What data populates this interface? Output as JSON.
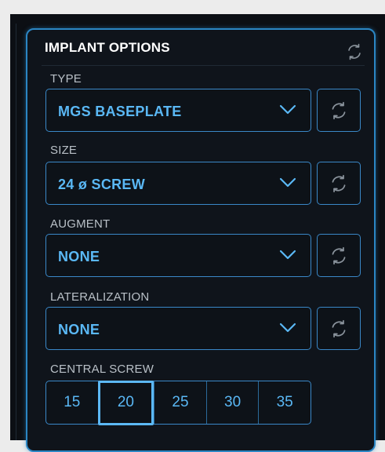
{
  "panel": {
    "title": "IMPLANT OPTIONS",
    "reset_icon": "reset-arrows-icon"
  },
  "fields": {
    "type": {
      "label": "TYPE",
      "value": "MGS BASEPLATE"
    },
    "size": {
      "label": "SIZE",
      "value": "24 ø SCREW"
    },
    "augment": {
      "label": "AUGMENT",
      "value": "NONE"
    },
    "lateralization": {
      "label": "LATERALIZATION",
      "value": "NONE"
    }
  },
  "central_screw": {
    "label": "CENTRAL SCREW",
    "options": [
      "15",
      "20",
      "25",
      "30",
      "35"
    ],
    "selected": "20"
  },
  "colors": {
    "accent": "#3a88c8",
    "value_text": "#5ab8f5",
    "panel_bg": "#0f141b"
  }
}
